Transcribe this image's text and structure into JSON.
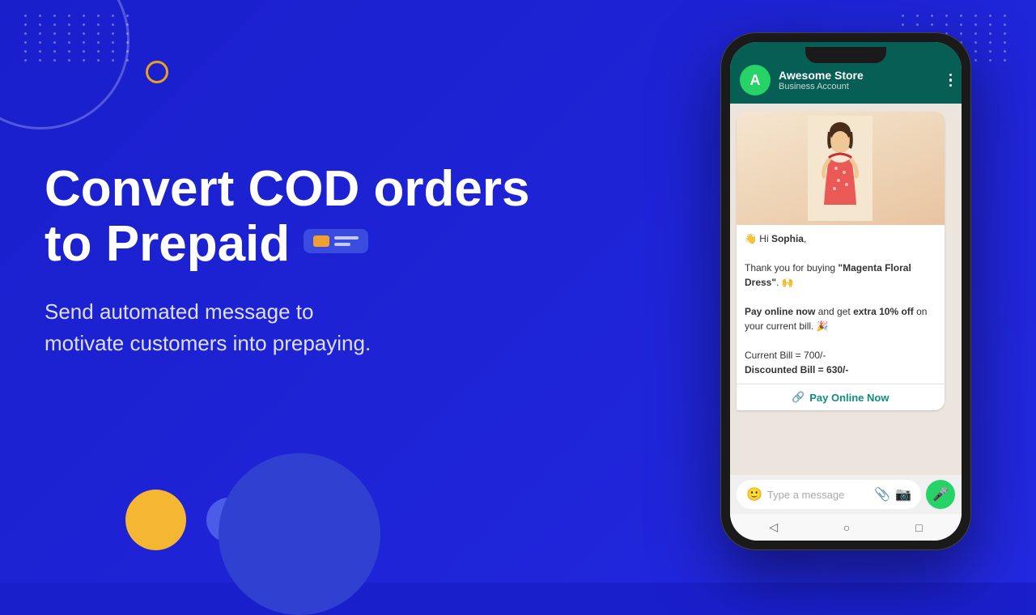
{
  "background": {
    "color": "#1a1fcc"
  },
  "decorative": {
    "dots_label": "decorative dots pattern",
    "circle_label": "decorative circle outline",
    "arc_label": "decorative arc"
  },
  "hero": {
    "headline_line1": "Convert COD orders",
    "headline_line2": "to Prepaid",
    "subtitle_line1": "Send automated message to",
    "subtitle_line2": "motivate customers into prepaying."
  },
  "phone": {
    "header": {
      "avatar_letter": "A",
      "business_name": "Awesome Store",
      "business_status": "Business Account"
    },
    "chat": {
      "greeting": "👋 Hi ",
      "customer_name": "Sophia",
      "greeting_end": ",",
      "thank_you_prefix": "Thank you for buying ",
      "product_name": "\"Magenta Floral Dress\"",
      "thank_you_suffix": ". 🙌",
      "offer_prefix": "Pay online now",
      "offer_middle": " and get ",
      "offer_bold": "extra 10% off",
      "offer_suffix": " on your current bill. 🎉",
      "current_bill_label": "Current Bill = 700/-",
      "discounted_bill_label": "Discounted Bill = 630/-",
      "pay_button_text": "Pay Online Now"
    },
    "input": {
      "placeholder": "Type a message"
    },
    "nav": {
      "back": "◁",
      "home": "○",
      "recent": "□"
    }
  }
}
